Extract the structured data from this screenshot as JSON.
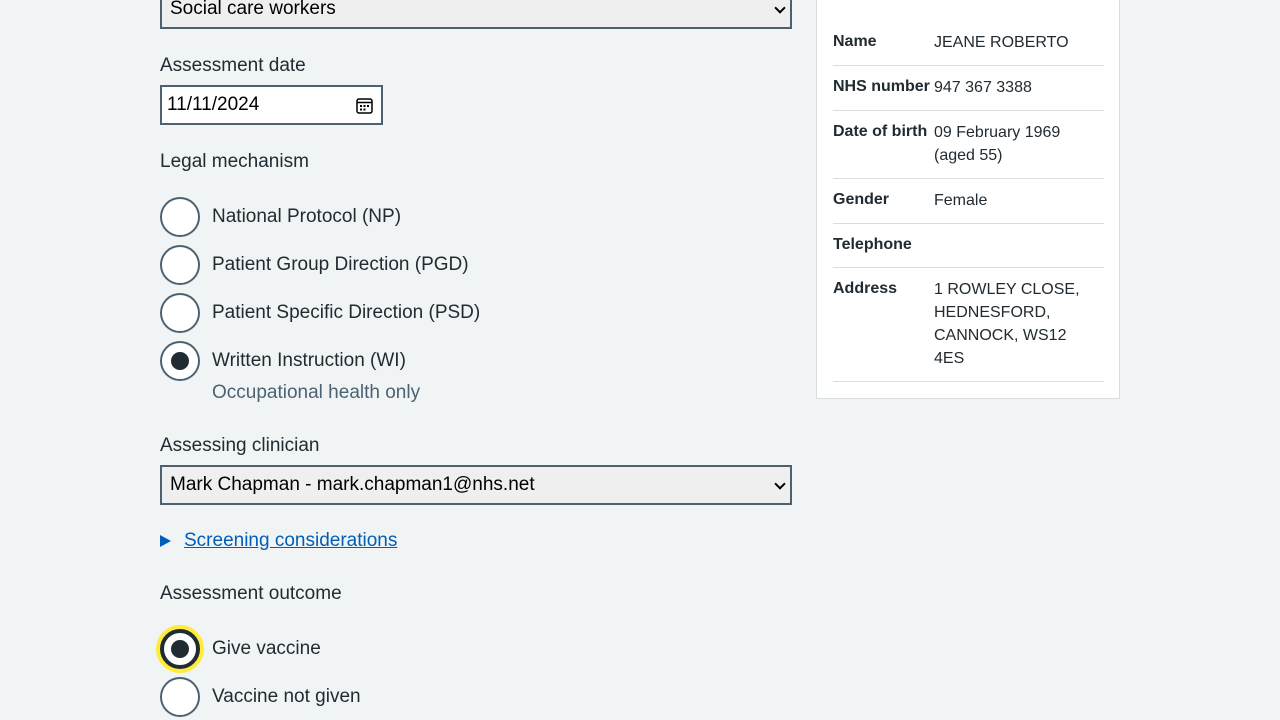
{
  "group_select": {
    "value": "Social care workers"
  },
  "assessment_date": {
    "label": "Assessment date",
    "value": "11/11/2024"
  },
  "legal_mechanism": {
    "label": "Legal mechanism",
    "options": [
      {
        "label": "National Protocol (NP)",
        "checked": false
      },
      {
        "label": "Patient Group Direction (PGD)",
        "checked": false
      },
      {
        "label": "Patient Specific Direction (PSD)",
        "checked": false
      },
      {
        "label": "Written Instruction (WI)",
        "checked": true,
        "hint": "Occupational health only"
      }
    ]
  },
  "assessing_clinician": {
    "label": "Assessing clinician",
    "value": "Mark Chapman - mark.chapman1@nhs.net"
  },
  "screening": {
    "link_text": "Screening considerations"
  },
  "assessment_outcome": {
    "label": "Assessment outcome",
    "options": [
      {
        "label": "Give vaccine",
        "checked": true
      },
      {
        "label": "Vaccine not given",
        "checked": false
      }
    ]
  },
  "patient": {
    "rows": [
      {
        "key": "Name",
        "value": "JEANE ROBERTO"
      },
      {
        "key": "NHS number",
        "value": "947 367 3388"
      },
      {
        "key": "Date of birth",
        "value": "09 February 1969 (aged 55)"
      },
      {
        "key": "Gender",
        "value": "Female"
      },
      {
        "key": "Telephone",
        "value": ""
      },
      {
        "key": "Address",
        "value": "1 ROWLEY CLOSE, HEDNESFORD, CANNOCK, WS12 4ES"
      }
    ]
  },
  "colors": {
    "link": "#005eb8",
    "focus": "#ffeb3b",
    "text": "#212b32",
    "secondary_text": "#4c6272",
    "background": "#f0f4f5"
  }
}
